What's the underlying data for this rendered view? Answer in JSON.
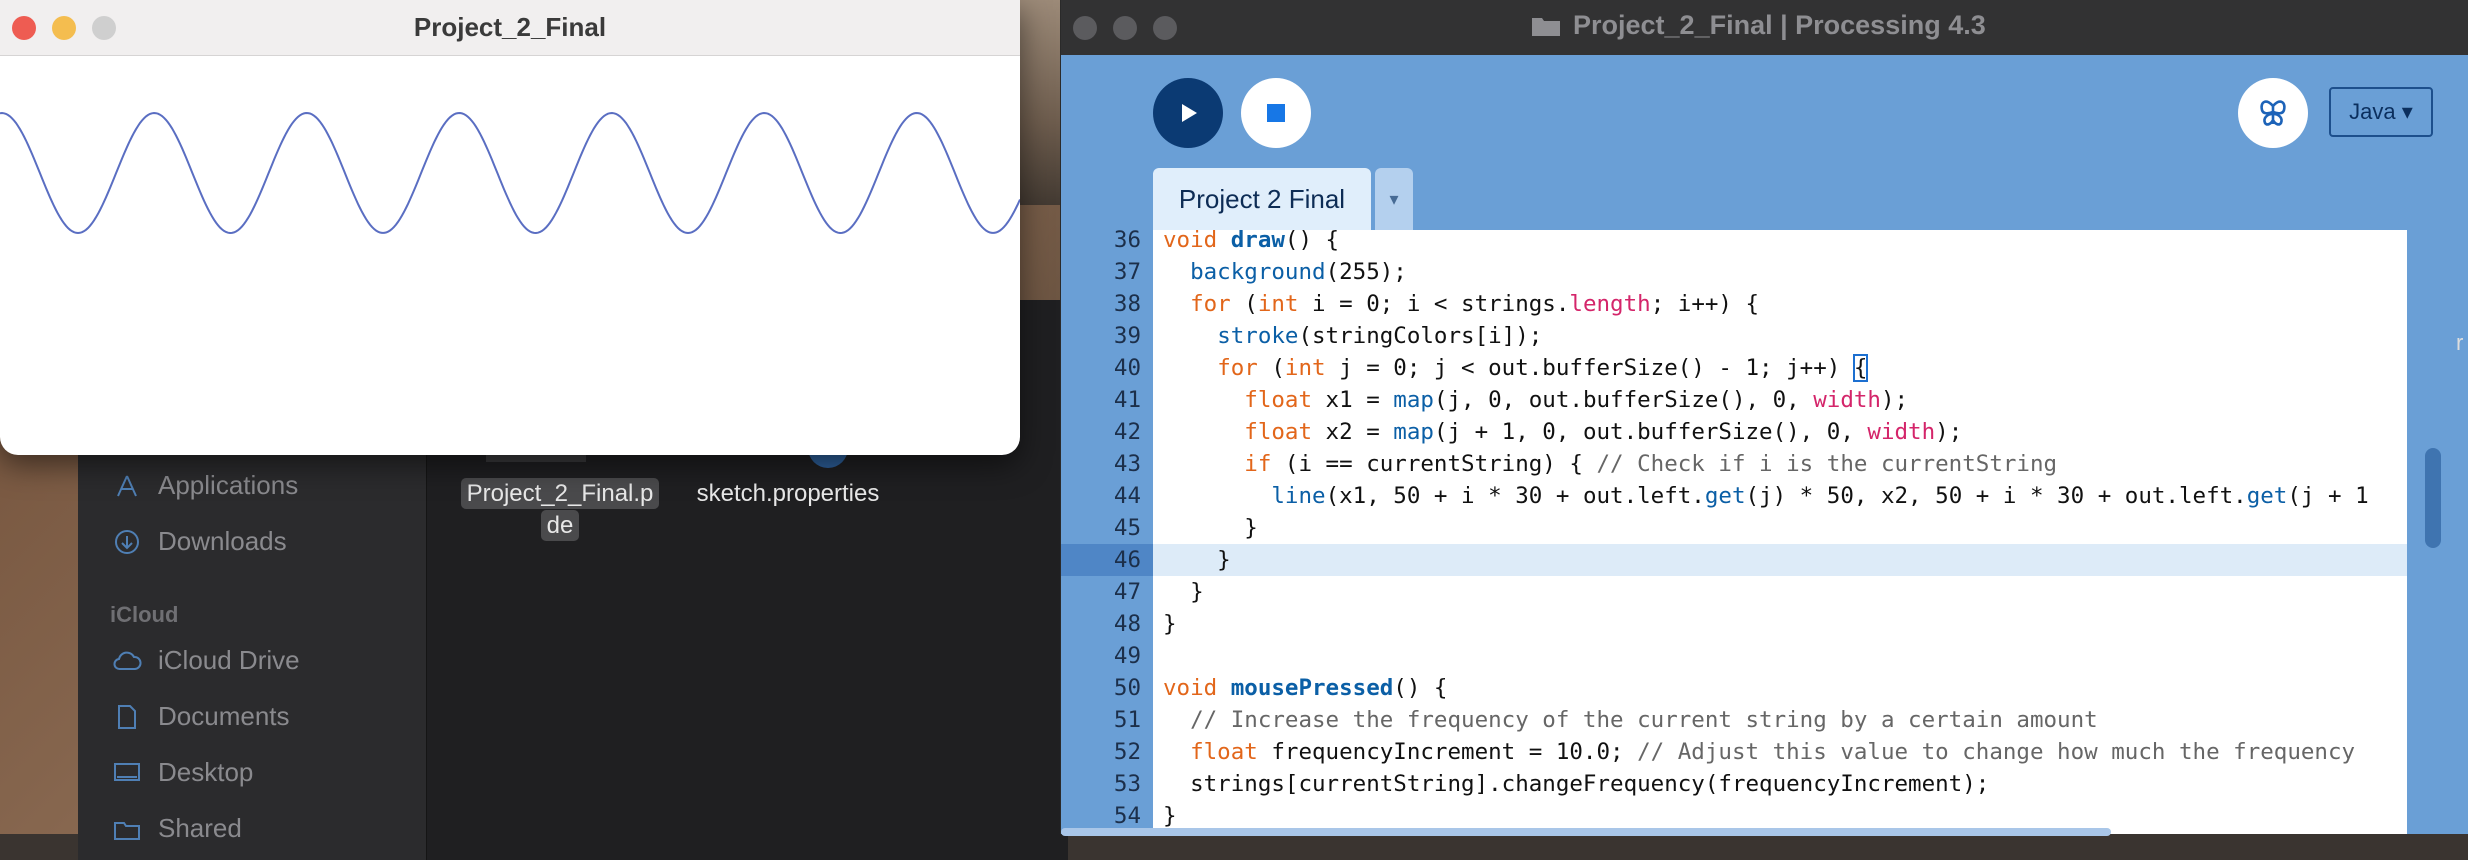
{
  "desktop": {
    "right_edge_char": "r"
  },
  "finder": {
    "sidebar": {
      "items": [
        {
          "label": "Applications",
          "icon": "applications-icon"
        },
        {
          "label": "Downloads",
          "icon": "downloads-icon"
        }
      ],
      "icloud_header": "iCloud",
      "icloud_items": [
        {
          "label": "iCloud Drive",
          "icon": "cloud-icon"
        },
        {
          "label": "Documents",
          "icon": "document-icon"
        },
        {
          "label": "Desktop",
          "icon": "desktop-icon"
        },
        {
          "label": "Shared",
          "icon": "shared-folder-icon"
        }
      ]
    },
    "files": [
      {
        "line1": "Project_2_Final.p",
        "line2": "de"
      },
      {
        "line1": "sketch.properties"
      }
    ]
  },
  "sketch_window": {
    "title": "Project_2_Final",
    "wave_color": "#5a6ec2",
    "background": "#ffffff"
  },
  "ide": {
    "title": "Project_2_Final | Processing 4.3",
    "mode": "Java ▾",
    "tab_label": "Project 2 Final",
    "tab_menu": "▾",
    "colors": {
      "toolbar": "#6a9fd6",
      "run": "#0b3a73",
      "highlight_line": "#ddebf8"
    },
    "lines": [
      {
        "n": "36",
        "code": "void draw() {"
      },
      {
        "n": "37",
        "code": "  background(255);"
      },
      {
        "n": "38",
        "code": "  for (int i = 0; i < strings.length; i++) {"
      },
      {
        "n": "39",
        "code": "    stroke(stringColors[i]);"
      },
      {
        "n": "40",
        "code": "    for (int j = 0; j < out.bufferSize() - 1; j++) {"
      },
      {
        "n": "41",
        "code": "      float x1 = map(j, 0, out.bufferSize(), 0, width);"
      },
      {
        "n": "42",
        "code": "      float x2 = map(j + 1, 0, out.bufferSize(), 0, width);"
      },
      {
        "n": "43",
        "code": "      if (i == currentString) { // Check if i is the currentString"
      },
      {
        "n": "44",
        "code": "        line(x1, 50 + i * 30 + out.left.get(j) * 50, x2, 50 + i * 30 + out.left.get(j + 1"
      },
      {
        "n": "45",
        "code": "      }"
      },
      {
        "n": "46",
        "code": "    }"
      },
      {
        "n": "47",
        "code": "  }"
      },
      {
        "n": "48",
        "code": "}"
      },
      {
        "n": "49",
        "code": ""
      },
      {
        "n": "50",
        "code": "void mousePressed() {"
      },
      {
        "n": "51",
        "code": "  // Increase the frequency of the current string by a certain amount"
      },
      {
        "n": "52",
        "code": "  float frequencyIncrement = 10.0; // Adjust this value to change how much the frequency"
      },
      {
        "n": "53",
        "code": "  strings[currentString].changeFrequency(frequencyIncrement);"
      },
      {
        "n": "54",
        "code": "}"
      }
    ],
    "highlighted_line": "46"
  }
}
